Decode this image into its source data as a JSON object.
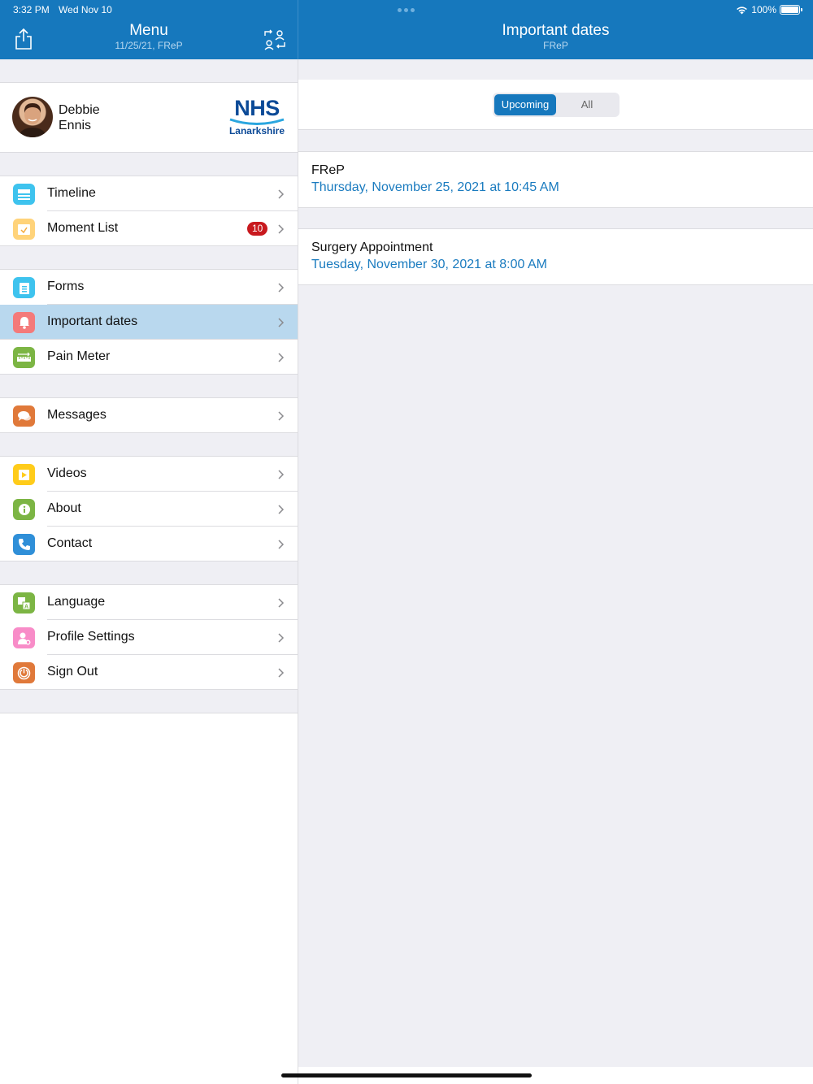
{
  "status": {
    "time": "3:32 PM",
    "date": "Wed Nov 10",
    "battery": "100%"
  },
  "menu_header": {
    "title": "Menu",
    "subtitle": "11/25/21, FReP"
  },
  "detail_header": {
    "title": "Important dates",
    "subtitle": "FReP"
  },
  "profile": {
    "first_name": "Debbie",
    "last_name": "Ennis"
  },
  "logo": {
    "word": "NHS",
    "place": "Lanarkshire"
  },
  "menu": {
    "timeline": "Timeline",
    "moment_list": "Moment List",
    "moment_badge": "10",
    "forms": "Forms",
    "important_dates": "Important dates",
    "pain_meter": "Pain Meter",
    "messages": "Messages",
    "videos": "Videos",
    "about": "About",
    "contact": "Contact",
    "language": "Language",
    "profile_settings": "Profile Settings",
    "sign_out": "Sign Out"
  },
  "segment": {
    "upcoming": "Upcoming",
    "all": "All",
    "selected": "Upcoming"
  },
  "events": [
    {
      "name": "FReP",
      "date": "Thursday, November 25, 2021 at 10:45 AM"
    },
    {
      "name": "Surgery Appointment",
      "date": "Tuesday, November 30, 2021 at 8:00 AM"
    }
  ],
  "colors": {
    "header": "#1678bd",
    "selected_row": "#b9d8ee",
    "link": "#1a7bbf",
    "badge": "#c8191e"
  }
}
